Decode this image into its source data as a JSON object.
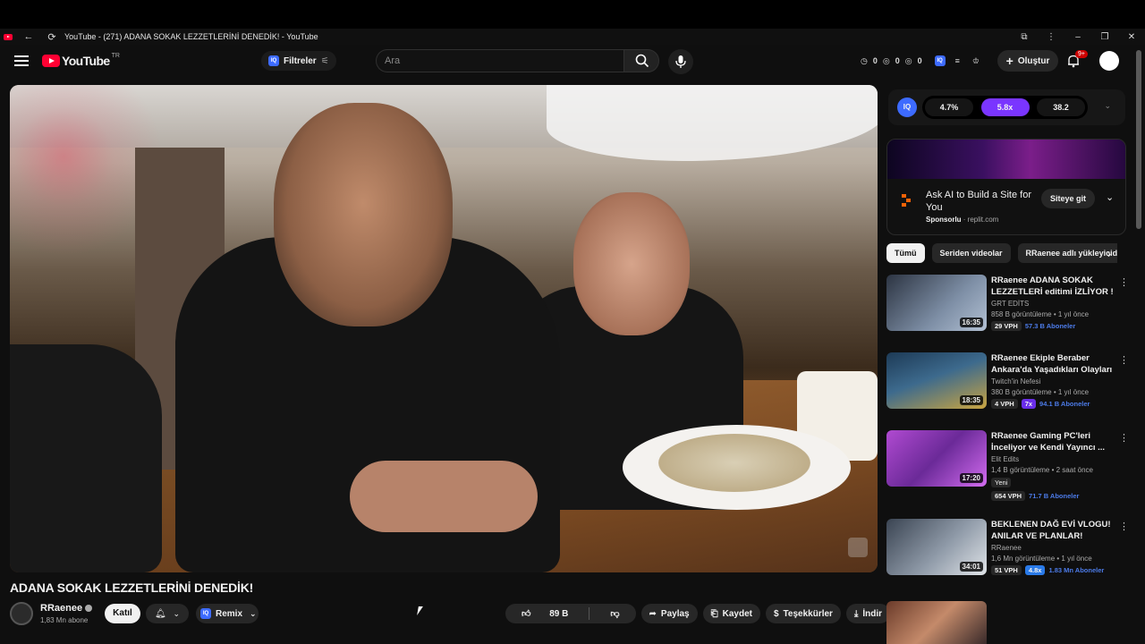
{
  "browser": {
    "tab_title": "YouTube - (271) ADANA SOKAK LEZZETLERİNİ DENEDİK! - YouTube"
  },
  "masthead": {
    "logo_text": "YouTube",
    "region": "TR",
    "filters_label": "Filtreler",
    "search_placeholder": "Ara",
    "stats": [
      "0",
      "0",
      "0"
    ],
    "create_label": "Oluştur",
    "notif_badge": "9+"
  },
  "video": {
    "title": "ADANA SOKAK LEZZETLERİNİ DENEDİK!",
    "channel_name": "RRaenee",
    "subscribers": "1,83 Mn abone",
    "join_label": "Katıl",
    "remix_label": "Remix",
    "likes": "89 B",
    "share_label": "Paylaş",
    "save_label": "Kaydet",
    "thanks_label": "Teşekkürler",
    "download_label": "İndir"
  },
  "iq_panel": {
    "stats": [
      "4.7%",
      "5.8x",
      "38.2"
    ],
    "active_index": 1
  },
  "ad": {
    "headline": "Ask AI to Build a Site for You",
    "sponsored_label": "Sponsorlu",
    "domain": "replit.com",
    "cta": "Siteye git"
  },
  "chips": [
    "Tümü",
    "Seriden videolar",
    "RRaenee adlı yükleyiciden"
  ],
  "recommendations": [
    {
      "title": "RRaenee ADANA SOKAK LEZZETLERİ editimi İZLİYOR !",
      "channel": "GRT EDİTS",
      "meta": "858 B görüntüleme • 1 yıl önce",
      "duration": "16:35",
      "vph": "29 VPH",
      "subs": "57.3 B Aboneler",
      "thumb_color": "#3b4a5e"
    },
    {
      "title": "RRaenee Ekiple Beraber Ankara'da Yaşadıkları Olayları ...",
      "channel": "Twitch'in Nefesi",
      "meta": "380 B görüntüleme • 1 yıl önce",
      "duration": "18:35",
      "vph": "4 VPH",
      "mult": "7x",
      "subs": "94.1 B Aboneler",
      "thumb_color": "#2f5170"
    },
    {
      "title": "RRaenee Gaming PC'leri İnceliyor ve Kendi Yayıncı ...",
      "channel": "Elit Edits",
      "meta": "1,4 B görüntüleme • 2 saat önce",
      "new_label": "Yeni",
      "duration": "17:20",
      "vph": "654 VPH",
      "subs": "71.7 B Aboneler",
      "thumb_color": "#6a2f8e"
    },
    {
      "title": "BEKLENEN DAĞ EVİ VLOGU! ANILAR VE PLANLAR!",
      "channel": "RRaenee",
      "meta": "1,6 Mn görüntüleme • 1 yıl önce",
      "duration": "34:01",
      "vph": "51 VPH",
      "mult": "4.8x",
      "subs": "1.83 Mn Aboneler",
      "thumb_color": "#4a5566"
    }
  ]
}
